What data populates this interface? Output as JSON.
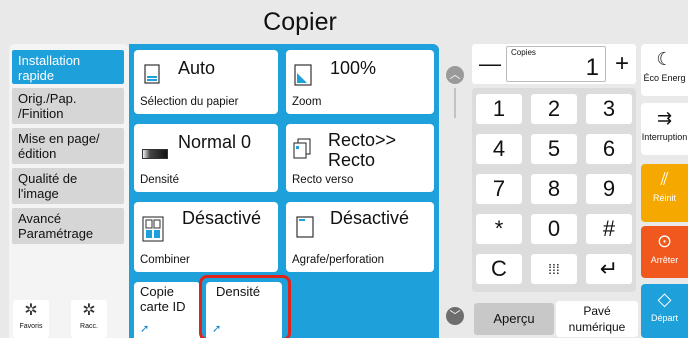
{
  "title": "Copier",
  "left_tabs": [
    {
      "label": "Installation rapide"
    },
    {
      "label": "Orig./Pap. /Finition"
    },
    {
      "label": "Mise en page/édition"
    },
    {
      "label": "Qualité de l'image"
    },
    {
      "label": "Avancé Paramétrage"
    }
  ],
  "shortcuts": [
    {
      "label": "Favoris",
      "icon": "gear-star-icon"
    },
    {
      "label": "Racc.",
      "icon": "gear-icon"
    }
  ],
  "tiles": {
    "paper": {
      "value": "Auto",
      "label": "Sélection du papier",
      "icon": "paper-tray-icon"
    },
    "zoom": {
      "value": "100%",
      "label": "Zoom",
      "icon": "zoom-page-icon"
    },
    "density": {
      "value": "Normal 0",
      "label": "Densité",
      "icon": "density-bar-icon"
    },
    "duplex": {
      "value": "Recto>> Recto",
      "label": "Recto verso",
      "icon": "duplex-pages-icon"
    },
    "combine": {
      "value": "Désactivé",
      "label": "Combiner",
      "icon": "combine-pages-icon"
    },
    "staple": {
      "value": "Désactivé",
      "label": "Agrafe/perforation",
      "icon": "staple-page-icon"
    },
    "id_copy": {
      "label": "Copie carte ID"
    },
    "density_shortcut": {
      "label": "Densité"
    }
  },
  "copies": {
    "label": "Copies",
    "value": "1",
    "minus": "—",
    "plus": "+"
  },
  "keypad": {
    "keys": [
      "1",
      "2",
      "3",
      "4",
      "5",
      "6",
      "7",
      "8",
      "9",
      "*",
      "0",
      "#",
      "C",
      "⁞⁞⁞",
      "↵"
    ]
  },
  "bottom": {
    "apercu": "Aperçu",
    "pave": "Pavé numérique"
  },
  "right_buttons": [
    {
      "label": "Éco Energ",
      "icon": "moon-icon"
    },
    {
      "label": "Interruption",
      "icon": "interrupt-icon"
    },
    {
      "label": "Réinit",
      "icon": "reset-icon"
    },
    {
      "label": "Arrêter",
      "icon": "stop-icon"
    },
    {
      "label": "Départ",
      "icon": "start-icon"
    }
  ],
  "colors": {
    "accent_blue": "#1ea1db",
    "reset_yellow": "#f5a800",
    "stop_orange": "#f0581e",
    "highlight_red": "#e2231a"
  }
}
